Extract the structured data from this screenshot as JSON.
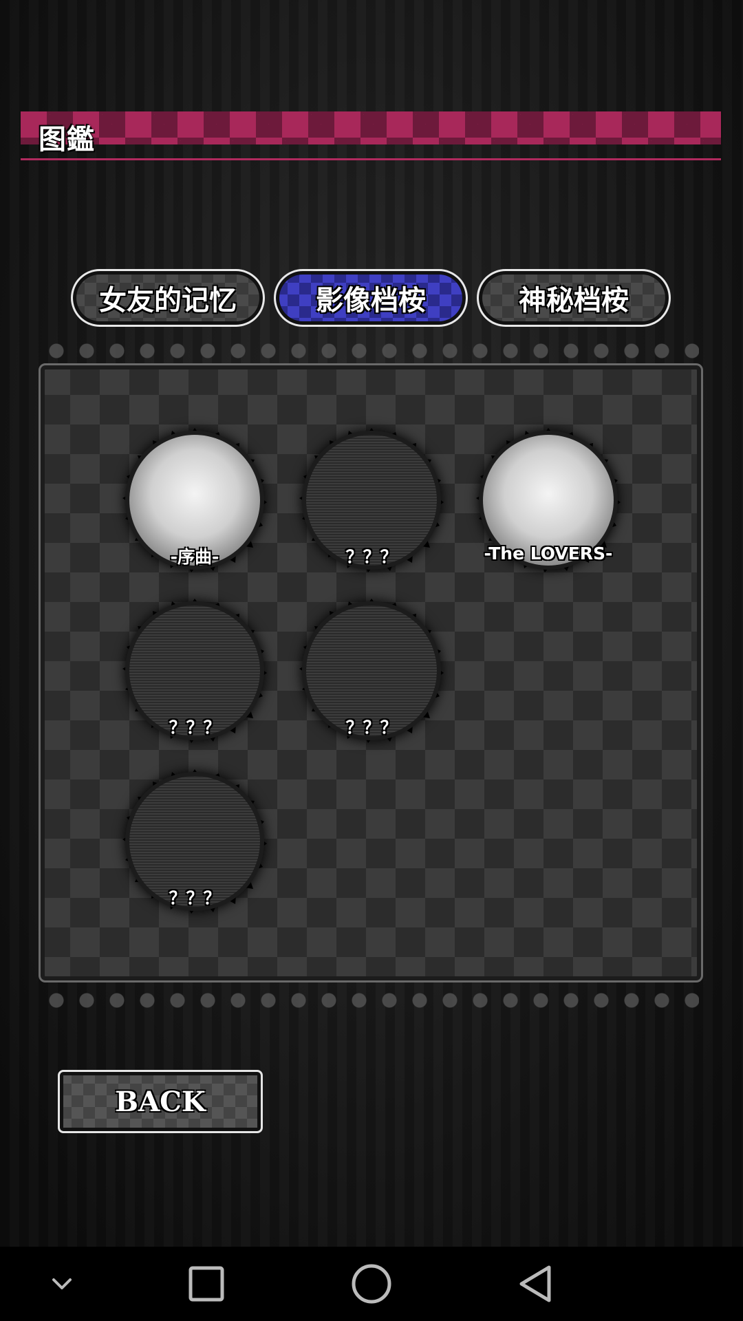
{
  "header": {
    "title": "图鑑"
  },
  "tabs": [
    {
      "label": "女友的记忆",
      "active": false
    },
    {
      "label": "影像档桉",
      "active": true
    },
    {
      "label": "神秘档桉",
      "active": false
    }
  ],
  "gallery": {
    "items": [
      {
        "label": "-序曲-",
        "locked": false
      },
      {
        "label": "？？？",
        "locked": true
      },
      {
        "label": "-The LOVERS-",
        "locked": false
      },
      {
        "label": "？？？",
        "locked": true
      },
      {
        "label": "？？？",
        "locked": true
      },
      {
        "label": "？？？",
        "locked": true
      }
    ]
  },
  "back_button": {
    "label": "BACK"
  },
  "navbar": {
    "icons": [
      "chevron-down-icon",
      "recent-apps-icon",
      "home-icon",
      "back-triangle-icon"
    ]
  },
  "colors": {
    "header_accent": "#a8285a",
    "active_tab": "#3f3fc2",
    "inactive_tab": "#4a4a4a"
  }
}
